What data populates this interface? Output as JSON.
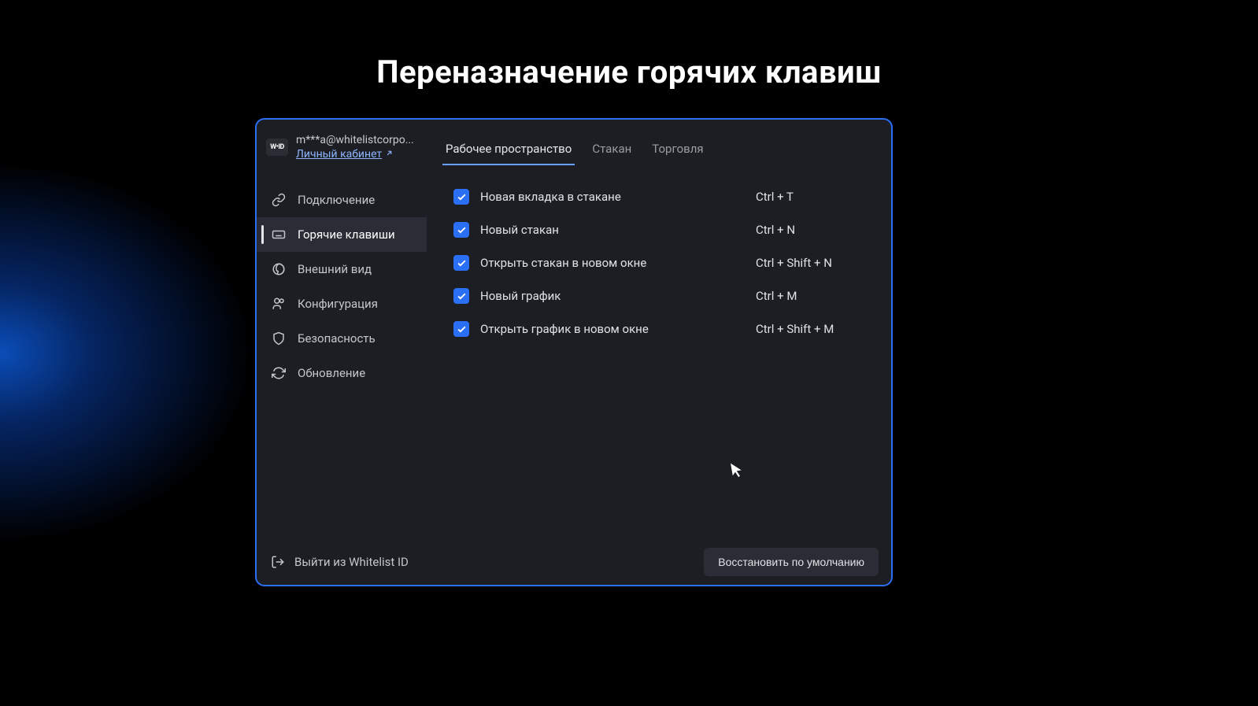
{
  "page": {
    "title": "Переназначение горячих клавиш"
  },
  "header": {
    "logo_text": "W•ID",
    "email": "m***a@whitelistcorpo...",
    "account_link": "Личный кабинет"
  },
  "tabs": [
    {
      "label": "Рабочее пространство",
      "active": true
    },
    {
      "label": "Стакан",
      "active": false
    },
    {
      "label": "Торговля",
      "active": false
    }
  ],
  "sidebar": {
    "items": [
      {
        "label": "Подключение",
        "icon": "link"
      },
      {
        "label": "Горячие клавиши",
        "icon": "keyboard",
        "active": true
      },
      {
        "label": "Внешний вид",
        "icon": "palette"
      },
      {
        "label": "Конфигурация",
        "icon": "users"
      },
      {
        "label": "Безопасность",
        "icon": "shield"
      },
      {
        "label": "Обновление",
        "icon": "refresh"
      }
    ]
  },
  "hotkeys": [
    {
      "label": "Новая вкладка в стакане",
      "keys": "Ctrl + T",
      "checked": true
    },
    {
      "label": "Новый стакан",
      "keys": "Ctrl + N",
      "checked": true
    },
    {
      "label": "Открыть стакан в новом окне",
      "keys": "Ctrl + Shift + N",
      "checked": true
    },
    {
      "label": "Новый график",
      "keys": "Ctrl + M",
      "checked": true
    },
    {
      "label": "Открыть график в новом окне",
      "keys": "Ctrl + Shift + M",
      "checked": true
    }
  ],
  "footer": {
    "logout": "Выйти из Whitelist ID",
    "reset": "Восстановить по умолчанию"
  },
  "colors": {
    "accent": "#2b6ff5",
    "bg": "#1c1e23",
    "text": "#e1e2e6"
  }
}
